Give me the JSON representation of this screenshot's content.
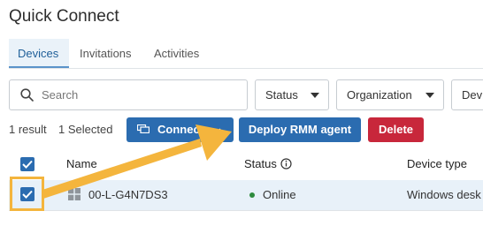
{
  "page": {
    "title": "Quick Connect"
  },
  "tabs": [
    {
      "label": "Devices"
    },
    {
      "label": "Invitations"
    },
    {
      "label": "Activities"
    }
  ],
  "filters": {
    "search": {
      "placeholder": "Search",
      "value": ""
    },
    "status": {
      "label": "Status"
    },
    "organization": {
      "label": "Organization"
    },
    "device": {
      "label": "Devi"
    }
  },
  "actions": {
    "result_count": "1 result",
    "selected_count": "1 Selected",
    "connect_label": "Connect",
    "deploy_label": "Deploy RMM agent",
    "delete_label": "Delete"
  },
  "table": {
    "columns": [
      "Name",
      "Status",
      "Device type"
    ],
    "rows": [
      {
        "name": "00-L-G4N7DS3",
        "status": "Online",
        "device_type": "Windows desk",
        "selected": true
      }
    ]
  },
  "colors": {
    "accent": "#2b6cb0",
    "danger": "#c8273b",
    "online": "#2e8b3e",
    "annotation": "#f4b53d"
  },
  "icons": [
    "search-icon",
    "caret-down-icon",
    "monitor-icon",
    "chevron-down-icon",
    "info-icon",
    "windows-icon",
    "checkmark-icon"
  ]
}
